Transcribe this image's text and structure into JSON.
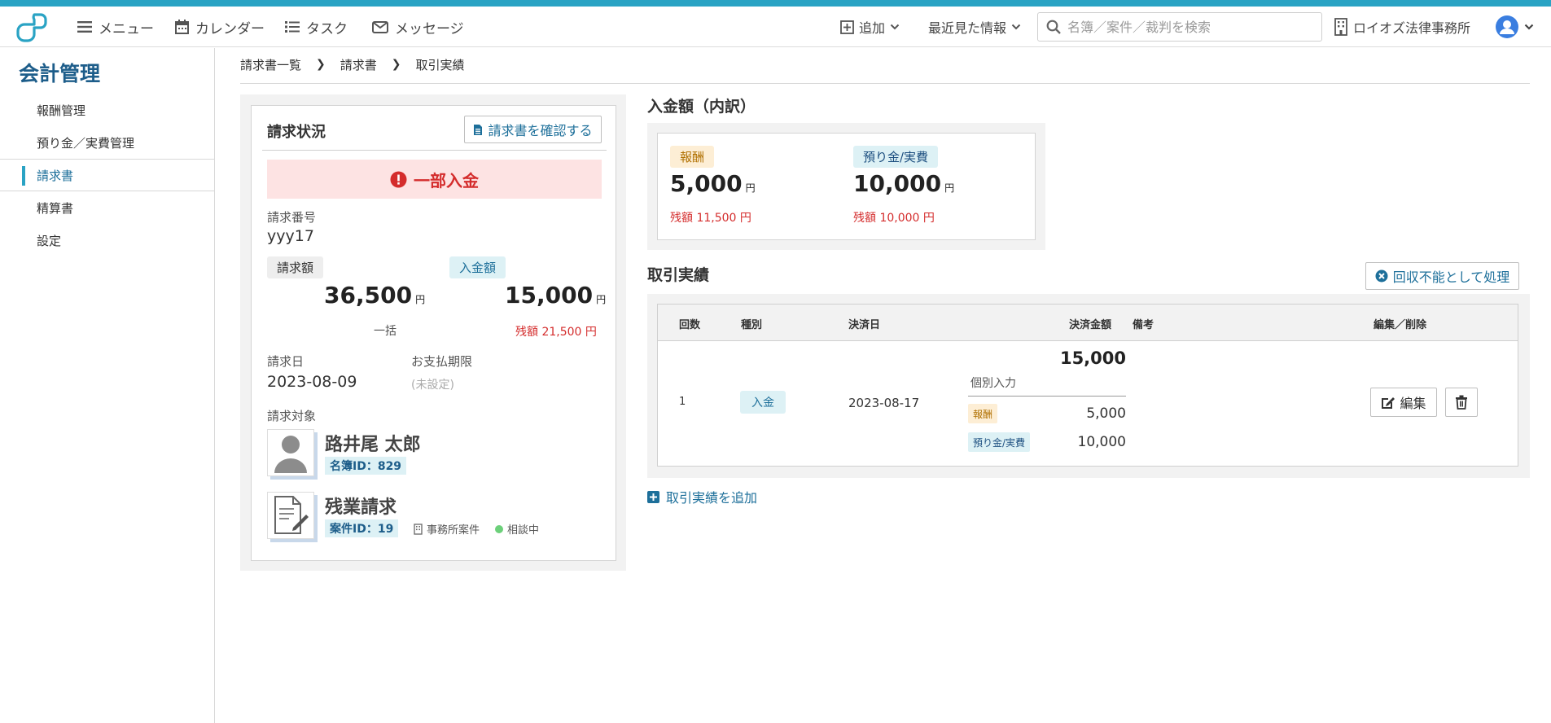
{
  "header": {
    "nav": [
      {
        "label": "メニュー",
        "icon": "menu-icon"
      },
      {
        "label": "カレンダー",
        "icon": "calendar-icon"
      },
      {
        "label": "タスク",
        "icon": "task-list-icon"
      },
      {
        "label": "メッセージ",
        "icon": "mail-icon"
      }
    ],
    "add_label": "追加",
    "recent_label": "最近見た情報",
    "search_placeholder": "名簿／案件／裁判を検索",
    "office_label": "ロイオズ法律事務所",
    "accent": "#2aa3c4"
  },
  "sidebar": {
    "title": "会計管理",
    "items": [
      {
        "label": "報酬管理"
      },
      {
        "label": "預り金／実費管理"
      },
      {
        "label": "請求書"
      },
      {
        "label": "精算書"
      },
      {
        "label": "設定"
      }
    ],
    "active_index": 2
  },
  "breadcrumb": [
    "請求書一覧",
    "請求書",
    "取引実績"
  ],
  "invoice": {
    "title": "請求状況",
    "confirm_button": "請求書を確認する",
    "status": "一部入金",
    "number_label": "請求番号",
    "number": "yyy17",
    "billed_label": "請求額",
    "billed_amount": "36,500",
    "billed_unit": "円",
    "billed_note": "一括",
    "paid_label": "入金額",
    "paid_amount": "15,000",
    "paid_unit": "円",
    "paid_remaining": "残額 21,500 円",
    "date_label": "請求日",
    "date": "2023-08-09",
    "due_label": "お支払期限",
    "due": "(未設定)",
    "target_label": "請求対象",
    "person_name": "路井尾 太郎",
    "person_id": "名簿ID：829",
    "case_name": "残業請求",
    "case_id": "案件ID：19",
    "case_type": "事務所案件",
    "case_status": "相談中"
  },
  "breakdown": {
    "title": "入金額（内訳）",
    "items": [
      {
        "label": "報酬",
        "amount": "5,000",
        "unit": "円",
        "remaining": "残額 11,500 円"
      },
      {
        "label": "預り金/実費",
        "amount": "10,000",
        "unit": "円",
        "remaining": "残額 10,000 円"
      }
    ]
  },
  "transactions": {
    "title": "取引実績",
    "uncollectible_button": "回収不能として処理",
    "columns": [
      "回数",
      "種別",
      "決済日",
      "決済金額",
      "備考",
      "編集／削除"
    ],
    "rows": [
      {
        "count": "1",
        "type": "入金",
        "date": "2023-08-17",
        "amount": "15,000",
        "input_type": "個別入力",
        "split": [
          {
            "label": "報酬",
            "amount": "5,000"
          },
          {
            "label": "預り金/実費",
            "amount": "10,000"
          }
        ],
        "note": "",
        "edit_label": "編集"
      }
    ],
    "add_link": "取引実績を追加"
  }
}
